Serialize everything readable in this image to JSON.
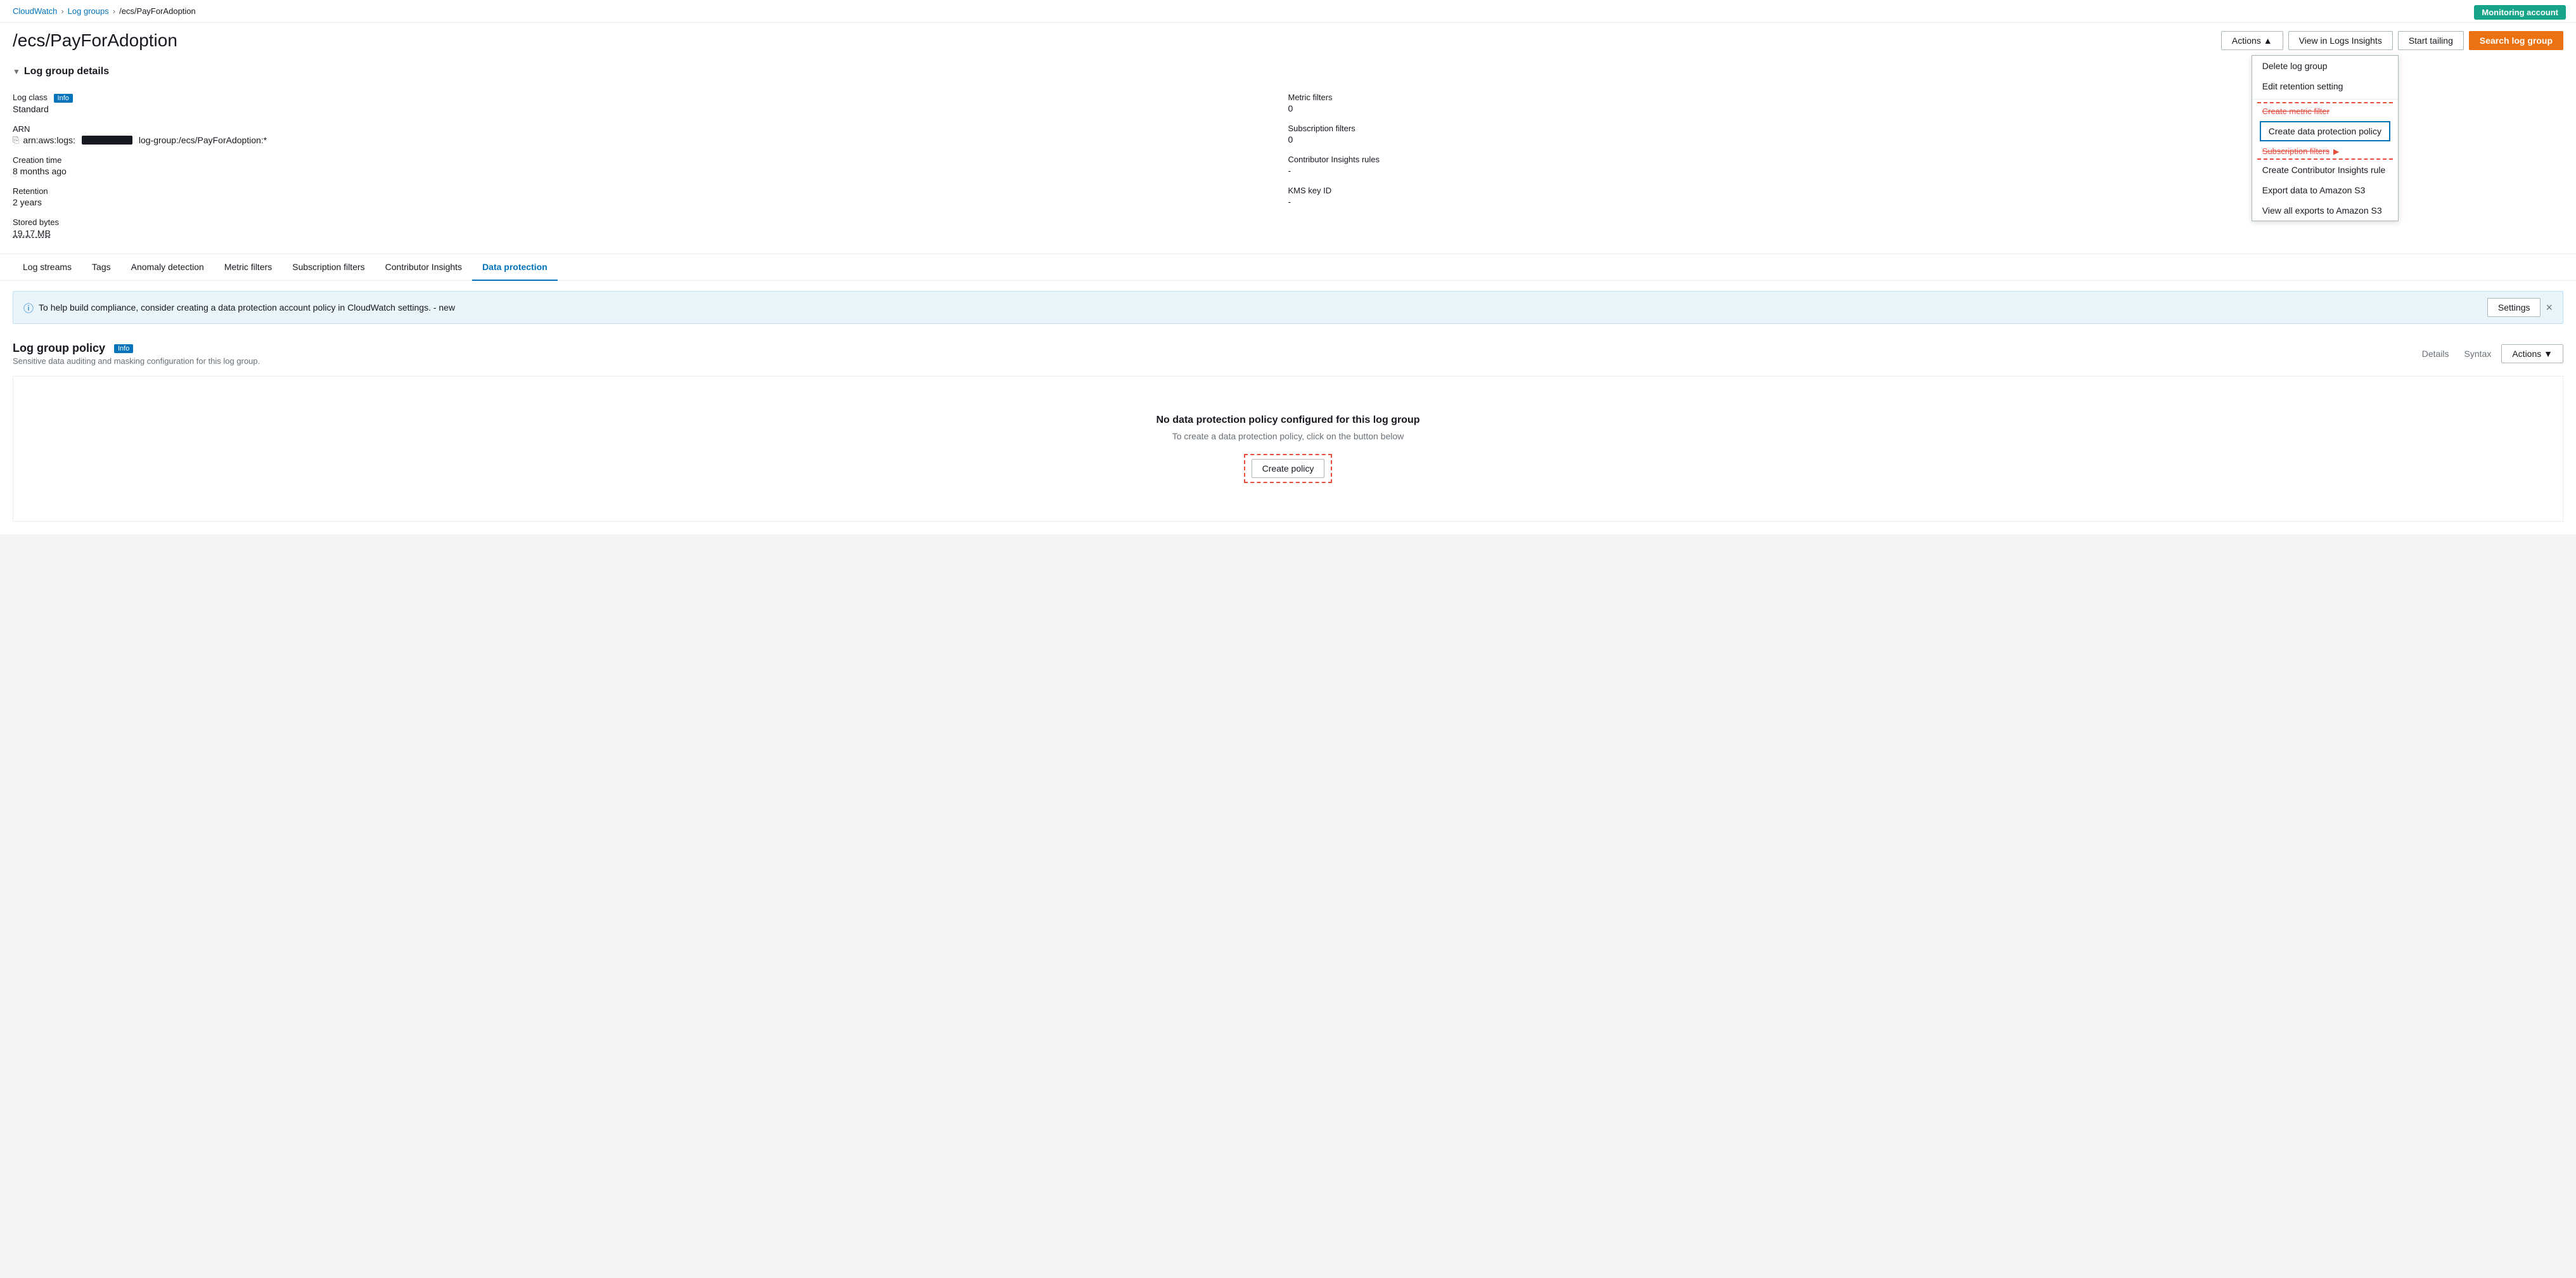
{
  "monitoring_badge": "Monitoring account",
  "breadcrumb": {
    "cloudwatch": "CloudWatch",
    "log_groups": "Log groups",
    "current": "/ecs/PayForAdoption"
  },
  "page_title": "/ecs/PayForAdoption",
  "toolbar": {
    "actions_label": "Actions ▲",
    "view_logs_insights": "View in Logs Insights",
    "start_tailing": "Start tailing",
    "search_log_group": "Search log group"
  },
  "dropdown_menu": {
    "delete_log_group": "Delete log group",
    "edit_retention": "Edit retention setting",
    "create_metric_filter": "Create metric filter",
    "create_data_protection": "Create data protection policy",
    "subscription_filters_label": "Subscription filters",
    "create_contributor": "Create Contributor Insights rule",
    "export_s3": "Export data to Amazon S3",
    "view_exports_s3": "View all exports to Amazon S3"
  },
  "log_group_details": {
    "section_title": "Log group details",
    "log_class_label": "Log class",
    "log_class_info": "Info",
    "log_class_value": "Standard",
    "arn_label": "ARN",
    "arn_prefix": "arn:aws:logs:",
    "arn_suffix": "log-group:/ecs/PayForAdoption:*",
    "creation_time_label": "Creation time",
    "creation_time_value": "8 months ago",
    "retention_label": "Retention",
    "retention_value": "2 years",
    "stored_bytes_label": "Stored bytes",
    "stored_bytes_value": "19.17 MB",
    "metric_filters_label": "Metric filters",
    "metric_filters_value": "0",
    "subscription_filters_label": "Subscription filters",
    "subscription_filters_value": "0",
    "contributor_insights_label": "Contributor Insights rules",
    "contributor_insights_value": "-",
    "kms_key_label": "KMS key ID",
    "kms_key_value": "-"
  },
  "tabs": [
    {
      "id": "log-streams",
      "label": "Log streams"
    },
    {
      "id": "tags",
      "label": "Tags"
    },
    {
      "id": "anomaly-detection",
      "label": "Anomaly detection"
    },
    {
      "id": "metric-filters",
      "label": "Metric filters"
    },
    {
      "id": "subscription-filters",
      "label": "Subscription filters"
    },
    {
      "id": "contributor-insights",
      "label": "Contributor Insights"
    },
    {
      "id": "data-protection",
      "label": "Data protection"
    }
  ],
  "active_tab": "data-protection",
  "info_banner": {
    "text": "To help build compliance, consider creating a data protection account policy in CloudWatch settings. - new",
    "settings_btn": "Settings",
    "close_btn": "×"
  },
  "policy_section": {
    "title": "Log group policy",
    "info_label": "Info",
    "subtitle": "Sensitive data auditing and masking configuration for this log group.",
    "details_btn": "Details",
    "syntax_btn": "Syntax",
    "actions_btn": "Actions ▼",
    "empty_title": "No data protection policy configured for this log group",
    "empty_desc": "To create a data protection policy, click on the button below",
    "create_policy_btn": "Create policy"
  }
}
